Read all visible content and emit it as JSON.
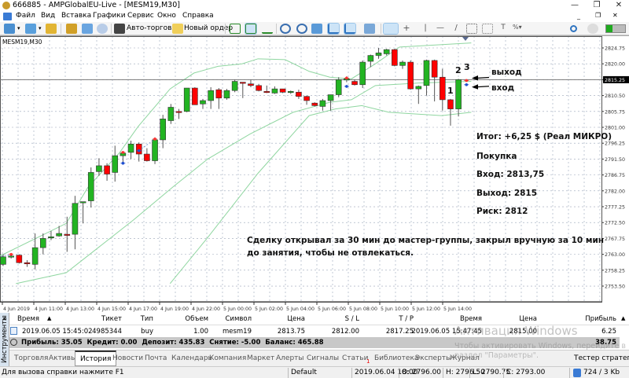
{
  "window": {
    "title": "666885 - AMPGlobalEU-Live - [MESM19,M30]",
    "minimize": "—",
    "restore": "❐",
    "close": "✕"
  },
  "menu": [
    "Файл",
    "Вид",
    "Вставка",
    "Графики",
    "Сервис",
    "Окно",
    "Справка"
  ],
  "toolbar": {
    "auto_trading": "Авто-торговля",
    "new_order": "Новый ордер"
  },
  "chart": {
    "symbol_label": "MESM19,M30",
    "colors": {
      "bull": "#22b422",
      "bear": "#ff0000",
      "band": "#8fd6a0",
      "grid": "#9aa4b8"
    },
    "bid_price": "2815.25",
    "price_ticks": [
      "2824.75",
      "2820.00",
      "2815.25",
      "2810.50",
      "2805.75",
      "2801.00",
      "2796.25",
      "2791.50",
      "2786.75",
      "2782.00",
      "2777.25",
      "2772.50",
      "2767.75",
      "2763.00",
      "2758.25",
      "2753.50"
    ],
    "time_ticks": [
      "4 Jun 2019",
      "4 Jun 11:00",
      "4 Jun 13:00",
      "4 Jun 15:00",
      "4 Jun 17:00",
      "4 Jun 19:00",
      "4 Jun 22:00",
      "5 Jun 00:00",
      "5 Jun 02:00",
      "5 Jun 04:00",
      "5 Jun 06:00",
      "5 Jun 08:00",
      "5 Jun 10:00",
      "5 Jun 12:00",
      "5 Jun 14:00"
    ],
    "candles_ohlc": [
      [
        2760.0,
        2763.0,
        2759.5,
        2762.25
      ],
      [
        2762.25,
        2763.25,
        2761.75,
        2762.5
      ],
      [
        2762.75,
        2763.0,
        2760.25,
        2760.5
      ],
      [
        2760.5,
        2761.25,
        2759.25,
        2760.25
      ],
      [
        2760.0,
        2769.25,
        2758.5,
        2765.0
      ],
      [
        2765.0,
        2769.25,
        2763.0,
        2767.75
      ],
      [
        2768.0,
        2770.0,
        2767.25,
        2768.25
      ],
      [
        2768.5,
        2771.5,
        2768.25,
        2769.25
      ],
      [
        2769.0,
        2774.25,
        2763.75,
        2768.75
      ],
      [
        2769.0,
        2780.5,
        2764.5,
        2778.25
      ],
      [
        2778.5,
        2778.75,
        2772.25,
        2778.75
      ],
      [
        2779.0,
        2789.0,
        2777.0,
        2787.5
      ],
      [
        2787.75,
        2791.75,
        2786.5,
        2789.5
      ],
      [
        2789.5,
        2790.25,
        2785.0,
        2787.0
      ],
      [
        2787.5,
        2795.5,
        2784.75,
        2792.5
      ],
      [
        2792.5,
        2793.75,
        2790.25,
        2793.25
      ],
      [
        2793.5,
        2797.0,
        2791.5,
        2796.0
      ],
      [
        2796.0,
        2796.5,
        2790.75,
        2793.0
      ],
      [
        2793.0,
        2794.75,
        2790.75,
        2791.0
      ],
      [
        2791.0,
        2798.0,
        2790.0,
        2797.25
      ],
      [
        2797.25,
        2804.75,
        2794.75,
        2803.5
      ],
      [
        2803.0,
        2808.0,
        2802.0,
        2807.0
      ],
      [
        2805.75,
        2806.5,
        2803.5,
        2805.5
      ],
      [
        2805.75,
        2812.75,
        2805.5,
        2812.75
      ],
      [
        2812.75,
        2813.0,
        2807.75,
        2807.75
      ],
      [
        2808.0,
        2809.5,
        2806.5,
        2809.0
      ],
      [
        2809.0,
        2813.0,
        2806.5,
        2812.0
      ],
      [
        2812.25,
        2812.75,
        2806.5,
        2809.75
      ],
      [
        2809.75,
        2812.5,
        2809.25,
        2812.0
      ],
      [
        2812.0,
        2815.25,
        2811.5,
        2814.75
      ],
      [
        2814.5,
        2814.5,
        2809.75,
        2814.25
      ],
      [
        2814.0,
        2815.25,
        2813.0,
        2813.5
      ],
      [
        2813.5,
        2814.0,
        2811.75,
        2812.0
      ],
      [
        2811.75,
        2813.5,
        2811.25,
        2811.5
      ],
      [
        2811.25,
        2813.25,
        2811.0,
        2812.5
      ],
      [
        2812.5,
        2812.5,
        2811.25,
        2811.5
      ],
      [
        2811.5,
        2812.0,
        2811.0,
        2811.75
      ],
      [
        2811.5,
        2812.25,
        2809.5,
        2810.25
      ],
      [
        2810.25,
        2810.5,
        2807.75,
        2809.0
      ],
      [
        2808.25,
        2808.5,
        2807.25,
        2807.5
      ],
      [
        2807.25,
        2809.5,
        2806.0,
        2809.0
      ],
      [
        2809.0,
        2810.5,
        2806.0,
        2810.75
      ],
      [
        2810.75,
        2816.0,
        2810.0,
        2815.25
      ],
      [
        2815.25,
        2816.25,
        2814.5,
        2815.5
      ],
      [
        2814.75,
        2815.25,
        2813.5,
        2813.75
      ],
      [
        2813.75,
        2821.0,
        2812.75,
        2820.5
      ],
      [
        2820.75,
        2822.75,
        2819.0,
        2822.5
      ],
      [
        2822.5,
        2824.75,
        2821.5,
        2823.25
      ],
      [
        2823.0,
        2824.5,
        2822.5,
        2824.25
      ],
      [
        2824.25,
        2824.5,
        2819.25,
        2819.5
      ],
      [
        2819.5,
        2821.0,
        2818.5,
        2820.5
      ],
      [
        2820.5,
        2821.0,
        2812.25,
        2812.5
      ],
      [
        2812.5,
        2813.5,
        2808.0,
        2813.25
      ],
      [
        2813.5,
        2821.25,
        2810.5,
        2821.0
      ],
      [
        2821.0,
        2821.25,
        2808.75,
        2816.0
      ],
      [
        2816.0,
        2818.5,
        2806.0,
        2809.25
      ],
      [
        2809.25,
        2809.5,
        2801.5,
        2806.5
      ],
      [
        2806.5,
        2815.5,
        2804.25,
        2815.25
      ]
    ],
    "bands": {
      "upper": [
        [
          0.6,
          2762.5
        ],
        [
          8.9,
          2772.25
        ],
        [
          11.6,
          2783.0
        ],
        [
          15.6,
          2793.5
        ],
        [
          17.9,
          2801.25
        ],
        [
          21.9,
          2812.5
        ],
        [
          24.9,
          2817.25
        ],
        [
          27.9,
          2819.25
        ],
        [
          30.9,
          2820.0
        ],
        [
          32.9,
          2821.5
        ],
        [
          36.3,
          2821.25
        ],
        [
          39.3,
          2817.75
        ],
        [
          41.9,
          2816.0
        ],
        [
          44.6,
          2815.5
        ],
        [
          47.6,
          2820.0
        ],
        [
          50.6,
          2825.0
        ],
        [
          59.6,
          2826.25
        ]
      ],
      "middle": [
        [
          2.6,
          2754.25
        ],
        [
          8.9,
          2757.5
        ],
        [
          17.3,
          2773.25
        ],
        [
          22.3,
          2783.25
        ],
        [
          26.6,
          2791.5
        ],
        [
          31.9,
          2799.0
        ],
        [
          37.3,
          2805.5
        ],
        [
          41.9,
          2808.5
        ],
        [
          44.6,
          2809.25
        ],
        [
          47.6,
          2813.5
        ],
        [
          53,
          2814.25
        ],
        [
          59.6,
          2814.75
        ]
      ],
      "lower": [
        [
          21.9,
          2754.25
        ],
        [
          26.6,
          2768.0
        ],
        [
          32.9,
          2787.25
        ],
        [
          39.3,
          2804.5
        ],
        [
          42.6,
          2806.5
        ],
        [
          45.9,
          2807.5
        ],
        [
          49.3,
          2805.5
        ],
        [
          55.9,
          2804.5
        ],
        [
          59.6,
          2805.5
        ]
      ]
    },
    "trade_markers": [
      {
        "i": 2,
        "price": 2763.0,
        "side": "exit"
      },
      {
        "i": 16,
        "price": 2793.5,
        "side": "exit"
      },
      {
        "i": 16,
        "price": 2790.25,
        "side": "entry"
      },
      {
        "i": 18,
        "price": 2794.0,
        "side": "entry"
      },
      {
        "i": 20,
        "price": 2797.5,
        "side": "exit"
      },
      {
        "i": 44,
        "price": 2815.75,
        "side": "exit"
      },
      {
        "i": 44,
        "price": 2813.25,
        "side": "entry"
      },
      {
        "i": 59,
        "price": 2815.0,
        "side": "exit"
      },
      {
        "i": 59,
        "price": 2813.75,
        "side": "entry"
      }
    ],
    "trade_lines": [
      [
        0,
        2762.0,
        2,
        2763.0
      ],
      [
        18,
        2794.0,
        20,
        2797.5
      ]
    ],
    "labels": {
      "c1": "1",
      "c2": "2",
      "c3": "3",
      "exit": "выход",
      "entry": "вход"
    },
    "notes": {
      "result": "Итог: +6,25 $ (Реал МИКРО)",
      "side": "Покупка",
      "entry": "Вход: 2813,75",
      "exit": "Выход: 2815",
      "risk": "Риск: 2812",
      "comment1": "Сделку открывал за 30 мин до мастер-группы, закрыл вручную за 10 мин",
      "comment2": "до занятия, чтобы не отвлекаться."
    }
  },
  "terminal": {
    "side_tab": "Инструменты",
    "columns": [
      "Время",
      "Тикет",
      "Тип",
      "Объем",
      "Символ",
      "Цена",
      "S / L",
      "T / P",
      "Время",
      "Цена",
      "Прибыль"
    ],
    "row": [
      "2019.06.05 15:45:02",
      "4985344",
      "buy",
      "1.00",
      "mesm19",
      "2813.75",
      "2812.00",
      "2817.25",
      "2019.06.05 15:47:45",
      "2815.00",
      "6.25"
    ],
    "summary": "Прибыль: 35.05  Кредит: 0.00  Депозит: 435.83  Снятие: -5.00  Баланс: 465.88",
    "summary_total": "38.75",
    "tabs": [
      "Торговля",
      "Активы",
      "История",
      "Новости",
      "Почта",
      "Календарь",
      "Компания",
      "Маркет",
      "Алерты",
      "Сигналы",
      "Статьи",
      "Библиотека",
      "Эксперты",
      "Журнал"
    ],
    "articles_badge": "1",
    "active_tab": "История",
    "tester": "Тестер стратегий"
  },
  "watermark": {
    "title": "Активация Windows",
    "line1": "Чтобы активировать Windows, перейдите в",
    "line2": "раздел \"Параметры\"."
  },
  "status": {
    "help": "Для вызова справки нажмите F1",
    "profile": "Default",
    "time": "2019.06.04 18:00",
    "open": "O: 2796.00",
    "high": "H: 2796.50",
    "low": "L: 2790.75",
    "close": "C: 2793.00",
    "traffic": "724 / 3 Kb"
  }
}
